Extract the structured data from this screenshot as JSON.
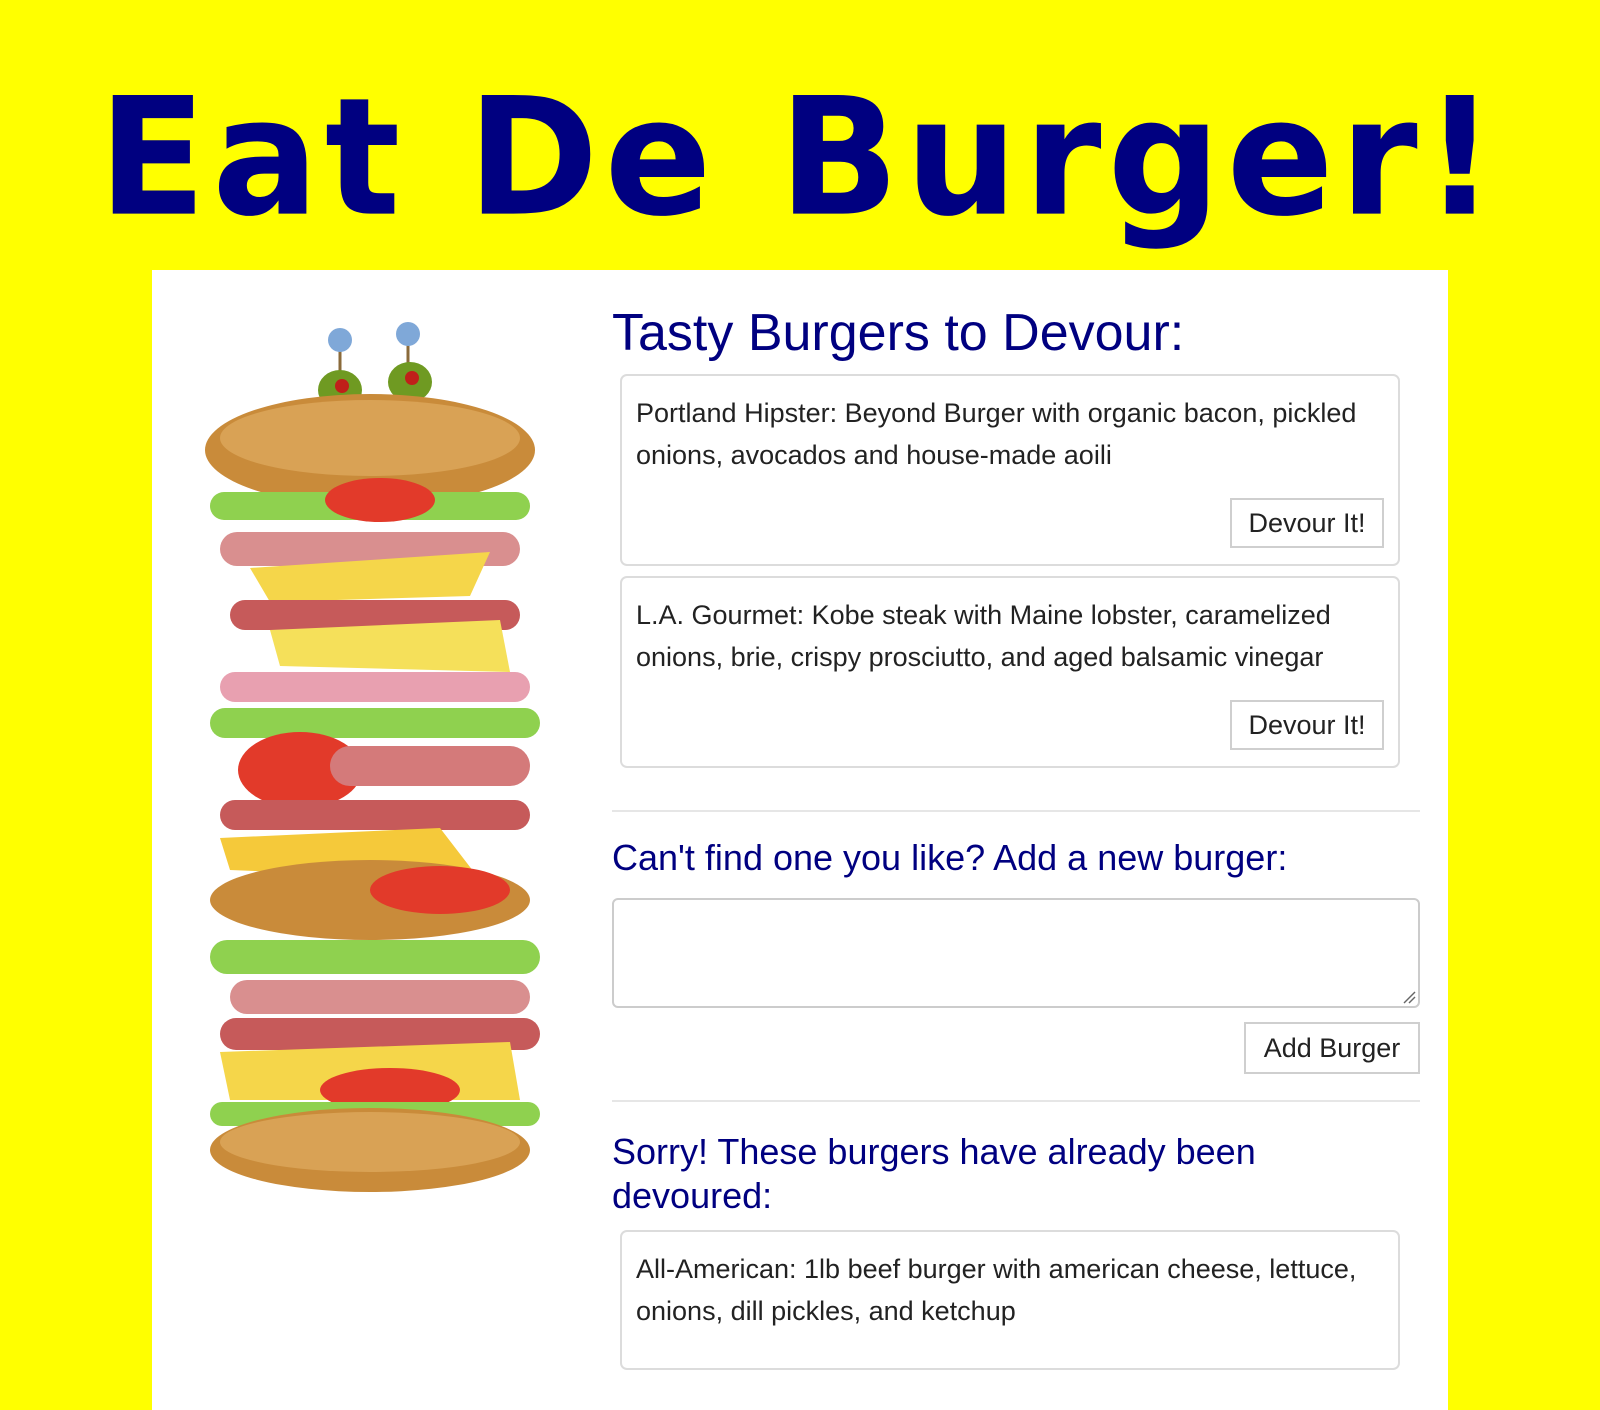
{
  "header": {
    "title": "Eat De Burger!"
  },
  "menu": {
    "heading": "Tasty Burgers to Devour:",
    "burgers": [
      {
        "name": "Portland Hipster: Beyond Burger with organic bacon, pickled onions, avocados and house-made aoili",
        "button_label": "Devour It!"
      },
      {
        "name": "L.A. Gourmet: Kobe steak with Maine lobster, caramelized onions, brie, crispy prosciutto, and aged balsamic vinegar",
        "button_label": "Devour It!"
      }
    ]
  },
  "add_form": {
    "heading": "Can't find one you like? Add a new burger:",
    "input_value": "",
    "button_label": "Add Burger"
  },
  "devoured": {
    "heading": "Sorry! These burgers have already been devoured:",
    "burgers": [
      {
        "name": "All-American: 1lb beef burger with american cheese, lettuce, onions, dill pickles, and ketchup"
      }
    ]
  },
  "colors": {
    "background": "#ffff00",
    "accent": "#000080",
    "panel": "#ffffff"
  },
  "icons": {
    "art": "tall-burger-illustration-icon",
    "resize": "resize-handle-icon"
  }
}
